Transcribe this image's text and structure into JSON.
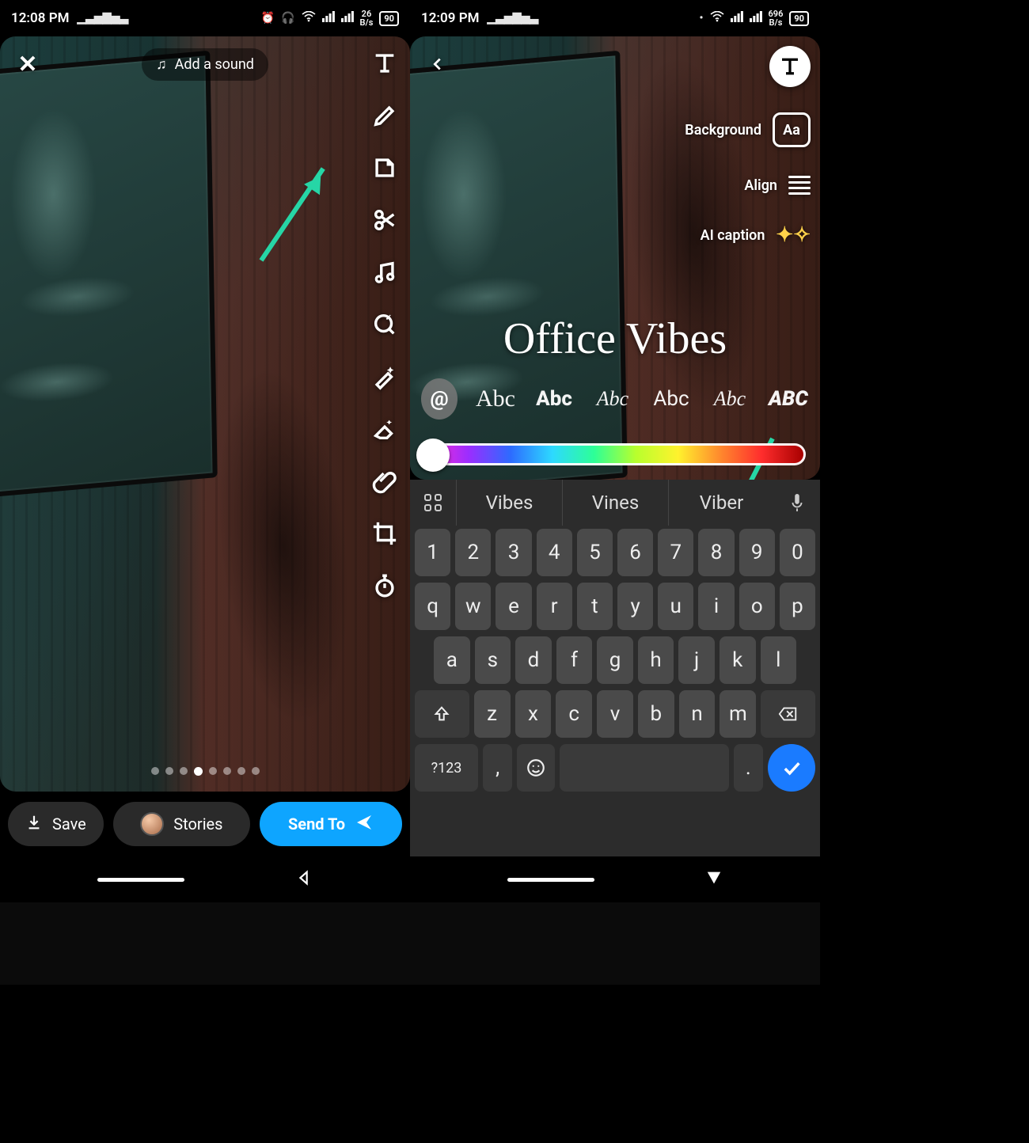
{
  "screen1": {
    "statusbar": {
      "time": "12:08 PM",
      "netspeed_top": "26",
      "netspeed_unit": "B/s",
      "battery": "90"
    },
    "add_sound": "Add a sound",
    "bottom": {
      "save": "Save",
      "stories": "Stories",
      "send_to": "Send To"
    },
    "tool_names": [
      "text",
      "pencil",
      "sticker",
      "scissors",
      "music",
      "lens",
      "magic",
      "eraser",
      "attachment",
      "crop",
      "timer"
    ]
  },
  "screen2": {
    "statusbar": {
      "time": "12:09 PM",
      "netspeed_top": "696",
      "netspeed_unit": "B/s",
      "battery": "90"
    },
    "tools": {
      "background": "Background",
      "background_box": "Aa",
      "align": "Align",
      "ai_caption": "AI caption"
    },
    "caption_text": "Office Vibes",
    "mention": "@",
    "font_samples": [
      "Abc",
      "Abc",
      "Abc",
      "Abc",
      "Abc",
      "ABC"
    ],
    "color_selected": "#ffffff",
    "keyboard": {
      "suggestions": [
        "Vibes",
        "Vines",
        "Viber"
      ],
      "row_num": [
        "1",
        "2",
        "3",
        "4",
        "5",
        "6",
        "7",
        "8",
        "9",
        "0"
      ],
      "row1": [
        "q",
        "w",
        "e",
        "r",
        "t",
        "y",
        "u",
        "i",
        "o",
        "p"
      ],
      "row2": [
        "a",
        "s",
        "d",
        "f",
        "g",
        "h",
        "j",
        "k",
        "l"
      ],
      "row3": [
        "z",
        "x",
        "c",
        "v",
        "b",
        "n",
        "m"
      ],
      "symkey": "?123",
      "comma": ",",
      "period": "."
    }
  }
}
